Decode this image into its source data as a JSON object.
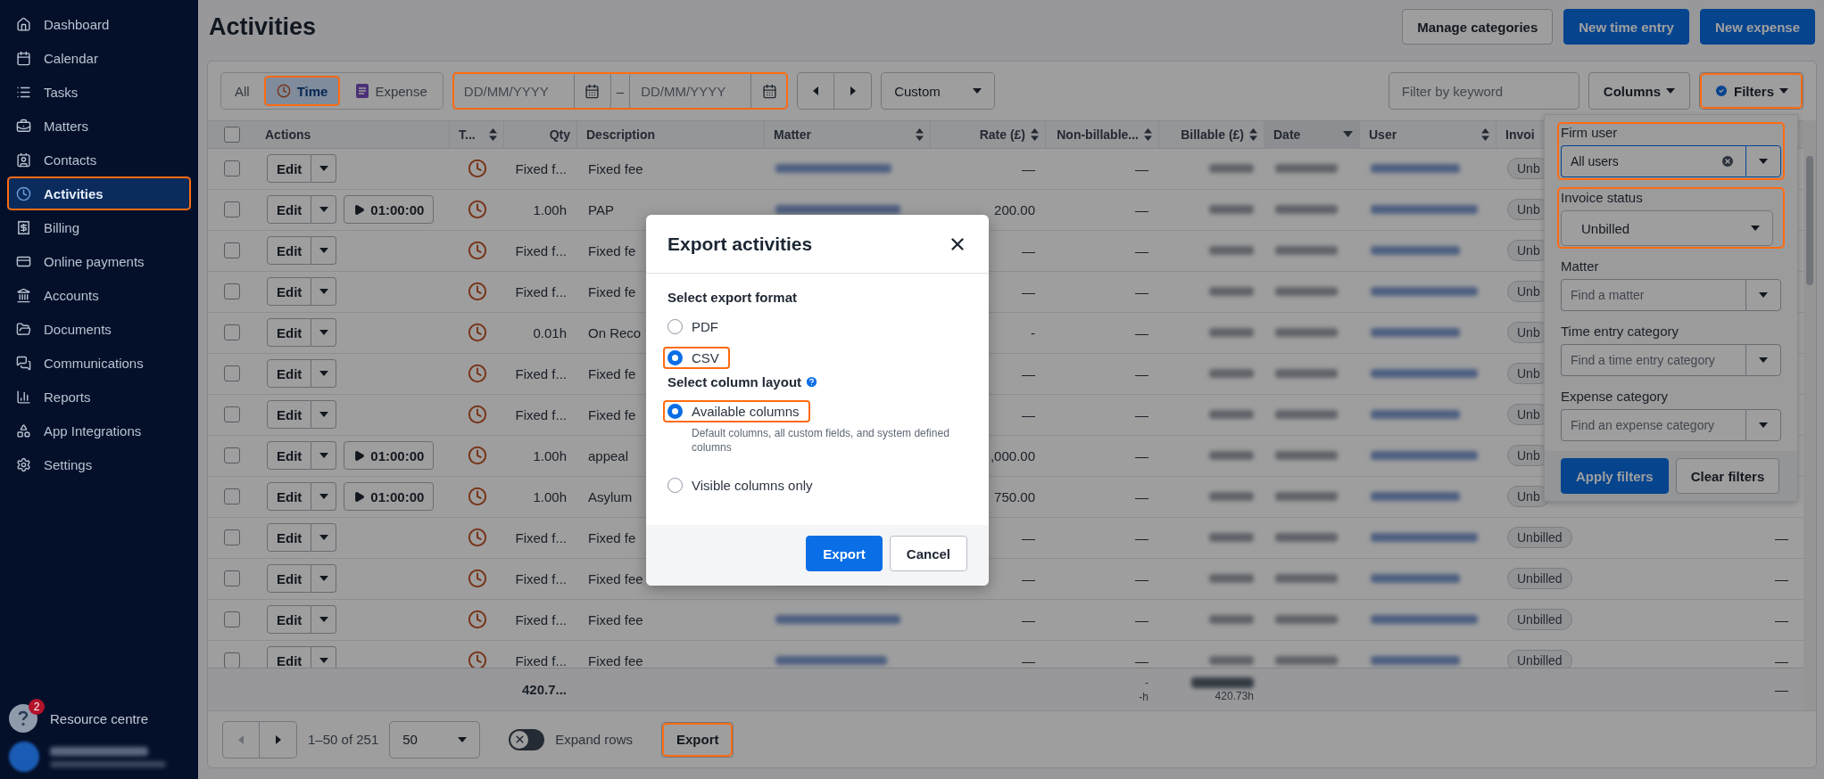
{
  "sidebar": {
    "items": [
      {
        "label": "Dashboard",
        "selected": false,
        "highlighted": false
      },
      {
        "label": "Calendar",
        "selected": false,
        "highlighted": false
      },
      {
        "label": "Tasks",
        "selected": false,
        "highlighted": false
      },
      {
        "label": "Matters",
        "selected": false,
        "highlighted": false
      },
      {
        "label": "Contacts",
        "selected": false,
        "highlighted": false
      },
      {
        "label": "Activities",
        "selected": true,
        "highlighted": true
      },
      {
        "label": "Billing",
        "selected": false,
        "highlighted": false
      },
      {
        "label": "Online payments",
        "selected": false,
        "highlighted": false
      },
      {
        "label": "Accounts",
        "selected": false,
        "highlighted": false
      },
      {
        "label": "Documents",
        "selected": false,
        "highlighted": false
      },
      {
        "label": "Communications",
        "selected": false,
        "highlighted": false
      },
      {
        "label": "Reports",
        "selected": false,
        "highlighted": false
      },
      {
        "label": "App Integrations",
        "selected": false,
        "highlighted": false
      },
      {
        "label": "Settings",
        "selected": false,
        "highlighted": false
      }
    ],
    "resource_centre": {
      "label": "Resource centre",
      "badge": "2"
    }
  },
  "header": {
    "title": "Activities",
    "buttons": [
      {
        "label": "Manage categories",
        "kind": "secondary"
      },
      {
        "label": "New time entry",
        "kind": "primary"
      },
      {
        "label": "New expense",
        "kind": "primary"
      }
    ]
  },
  "toolbar": {
    "type_tabs": [
      {
        "label": "All",
        "selected": false,
        "highlighted": false
      },
      {
        "label": "Time",
        "selected": true,
        "highlighted": true
      },
      {
        "label": "Expense",
        "selected": false,
        "highlighted": false
      }
    ],
    "date_range": {
      "from_placeholder": "DD/MM/YYYY",
      "separator": "–",
      "to_placeholder": "DD/MM/YYYY",
      "highlighted": true
    },
    "period_select": "Custom",
    "keyword_placeholder": "Filter by keyword",
    "columns_button": "Columns",
    "filters_button": {
      "label": "Filters",
      "highlighted": true
    }
  },
  "table": {
    "select_all_checked": false,
    "columns": [
      {
        "label": "Actions",
        "sortable": false,
        "sorted_descending": false
      },
      {
        "label": "T...",
        "sortable": true,
        "sorted_descending": false
      },
      {
        "label": "Qty",
        "sortable": false,
        "sorted_descending": false
      },
      {
        "label": "Description",
        "sortable": false,
        "sorted_descending": false
      },
      {
        "label": "Matter",
        "sortable": true,
        "sorted_descending": false
      },
      {
        "label": "Rate (£)",
        "sortable": true,
        "sorted_descending": false
      },
      {
        "label": "Non-billable...",
        "sortable": true,
        "sorted_descending": false
      },
      {
        "label": "Billable (£)",
        "sortable": true,
        "sorted_descending": false
      },
      {
        "label": "Date",
        "sortable": true,
        "sorted_descending": true
      },
      {
        "label": "User",
        "sortable": true,
        "sorted_descending": false
      },
      {
        "label": "Invoi",
        "sortable": false,
        "sorted_descending": false
      }
    ],
    "rows": [
      {
        "checked": false,
        "edit": "Edit",
        "qty": "Fixed f...",
        "description": "Fixed fee",
        "rate": "—",
        "non_billable": "—",
        "invoice_status": "Unb"
      },
      {
        "checked": false,
        "edit": "Edit",
        "timer": "01:00:00",
        "qty": "1.00h",
        "description": "PAP",
        "rate": "200.00",
        "non_billable": "—",
        "invoice_status": "Unb"
      },
      {
        "checked": false,
        "edit": "Edit",
        "qty": "Fixed f...",
        "description": "Fixed fe",
        "rate": "—",
        "non_billable": "—",
        "invoice_status": "Unb"
      },
      {
        "checked": false,
        "edit": "Edit",
        "qty": "Fixed f...",
        "description": "Fixed fe",
        "rate": "—",
        "non_billable": "—",
        "invoice_status": "Unb"
      },
      {
        "checked": false,
        "edit": "Edit",
        "qty": "0.01h",
        "description": "On Reco",
        "rate": "-",
        "non_billable": "—",
        "invoice_status": "Unb"
      },
      {
        "checked": false,
        "edit": "Edit",
        "qty": "Fixed f...",
        "description": "Fixed fe",
        "rate": "—",
        "non_billable": "—",
        "invoice_status": "Unb"
      },
      {
        "checked": false,
        "edit": "Edit",
        "qty": "Fixed f...",
        "description": "Fixed fe",
        "rate": "—",
        "non_billable": "—",
        "invoice_status": "Unb"
      },
      {
        "checked": false,
        "edit": "Edit",
        "timer": "01:00:00",
        "qty": "1.00h",
        "description": "appeal",
        "rate": ",000.00",
        "non_billable": "—",
        "invoice_status": "Unb"
      },
      {
        "checked": false,
        "edit": "Edit",
        "timer": "01:00:00",
        "qty": "1.00h",
        "description": "Asylum",
        "rate": "750.00",
        "non_billable": "—",
        "invoice_status": "Unb"
      },
      {
        "checked": false,
        "edit": "Edit",
        "qty": "Fixed f...",
        "description": "Fixed fe",
        "rate": "—",
        "non_billable": "—",
        "invoice_status": "Unbilled",
        "column_13": "—"
      },
      {
        "checked": false,
        "edit": "Edit",
        "qty": "Fixed f...",
        "description": "Fixed fee",
        "rate": "—",
        "non_billable": "—",
        "invoice_status": "Unbilled",
        "column_13": "—"
      },
      {
        "checked": false,
        "edit": "Edit",
        "qty": "Fixed f...",
        "description": "Fixed fee",
        "rate": "—",
        "non_billable": "—",
        "invoice_status": "Unbilled",
        "column_13": "—"
      },
      {
        "checked": false,
        "edit": "Edit",
        "qty": "Fixed f...",
        "description": "Fixed fee",
        "rate": "—",
        "non_billable": "—",
        "invoice_status": "Unbilled",
        "column_13": "—"
      }
    ],
    "totals": {
      "qty": "420.7...",
      "non_billable": "-",
      "non_billable_hours": "-h",
      "billable_hours": "420.73h",
      "column_13": "—"
    }
  },
  "pagination": {
    "prev_disabled": true,
    "next_disabled": false,
    "range": "1–50 of 251",
    "page_size": "50",
    "expand_rows": {
      "label": "Expand rows",
      "on": false
    },
    "export_button": {
      "label": "Export",
      "highlighted": true
    }
  },
  "filters_panel": {
    "fields": [
      {
        "label": "Firm user",
        "kind": "combo",
        "value": "All users",
        "highlighted": true
      },
      {
        "label": "Invoice status",
        "kind": "select",
        "value": "Unbilled",
        "highlighted": true
      },
      {
        "label": "Matter",
        "kind": "combo",
        "placeholder": "Find a matter",
        "highlighted": false
      },
      {
        "label": "Time entry category",
        "kind": "combo",
        "placeholder": "Find a time entry category",
        "highlighted": false
      },
      {
        "label": "Expense category",
        "kind": "combo",
        "placeholder": "Find an expense category",
        "highlighted": false
      }
    ],
    "buttons": [
      {
        "label": "Apply filters",
        "kind": "primary"
      },
      {
        "label": "Clear filters",
        "kind": "secondary"
      }
    ]
  },
  "modal": {
    "title": "Export activities",
    "sections": [
      {
        "heading": "Select export format",
        "help": false,
        "options": [
          {
            "label": "PDF",
            "selected": false,
            "highlighted": false
          },
          {
            "label": "CSV",
            "selected": true,
            "highlighted": true
          }
        ]
      },
      {
        "heading": "Select column layout",
        "help": true,
        "options": [
          {
            "label": "Available columns",
            "description": "Default columns, all custom fields, and system defined columns",
            "selected": true,
            "highlighted": true
          },
          {
            "label": "Visible columns only",
            "selected": false,
            "highlighted": false
          }
        ]
      }
    ],
    "buttons": [
      {
        "label": "Export",
        "kind": "primary"
      },
      {
        "label": "Cancel",
        "kind": "secondary"
      }
    ]
  }
}
